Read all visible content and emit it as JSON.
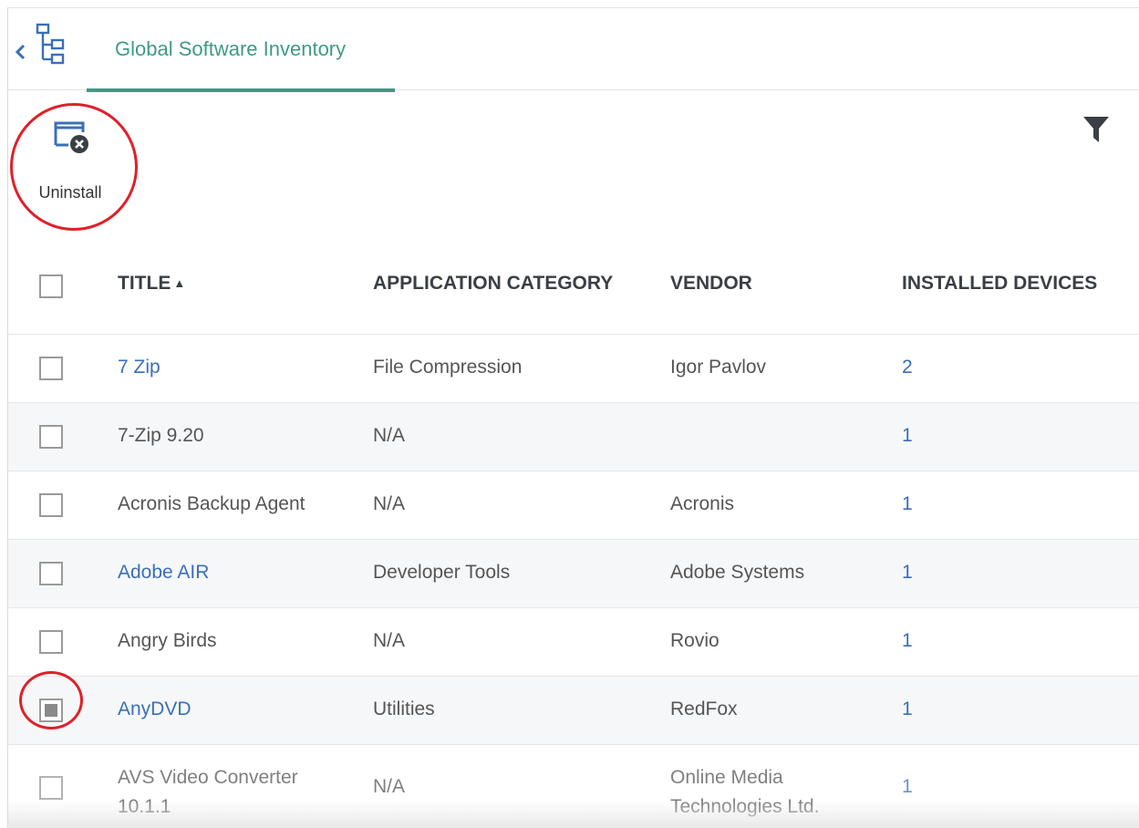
{
  "tabs": [
    {
      "label": "Global Software Inventory",
      "active": true
    }
  ],
  "toolbar": {
    "uninstall_label": "Uninstall"
  },
  "icons": {
    "back": "chevron-left-icon",
    "tree": "device-tree-icon",
    "uninstall": "window-close-icon",
    "filter": "filter-icon"
  },
  "table": {
    "columns": {
      "title": "TITLE",
      "category": "APPLICATION CATEGORY",
      "vendor": "VENDOR",
      "devices": "INSTALLED DEVICES"
    },
    "sort": {
      "column": "title",
      "direction": "ascending"
    },
    "rows": [
      {
        "title": "7 Zip",
        "category": "File Compression",
        "vendor": "Igor Pavlov",
        "devices": "2",
        "checked": false
      },
      {
        "title": "7-Zip 9.20",
        "category": "N/A",
        "vendor": "",
        "devices": "1",
        "checked": false
      },
      {
        "title": "Acronis Backup Agent",
        "category": "N/A",
        "vendor": "Acronis",
        "devices": "1",
        "checked": false
      },
      {
        "title": "Adobe AIR",
        "category": "Developer Tools",
        "vendor": "Adobe Systems",
        "devices": "1",
        "checked": false
      },
      {
        "title": "Angry Birds",
        "category": "N/A",
        "vendor": "Rovio",
        "devices": "1",
        "checked": false
      },
      {
        "title": "AnyDVD",
        "category": "Utilities",
        "vendor": "RedFox",
        "devices": "1",
        "checked": true
      },
      {
        "title": "AVS Video Converter 10.1.1",
        "category": "N/A",
        "vendor": "Online Media Technologies Ltd.",
        "devices": "1",
        "checked": false
      }
    ]
  },
  "colors": {
    "accent": "#3f9a86",
    "link": "#3b6fb6",
    "highlight": "#e0202a",
    "header_text": "#3a3f45"
  }
}
